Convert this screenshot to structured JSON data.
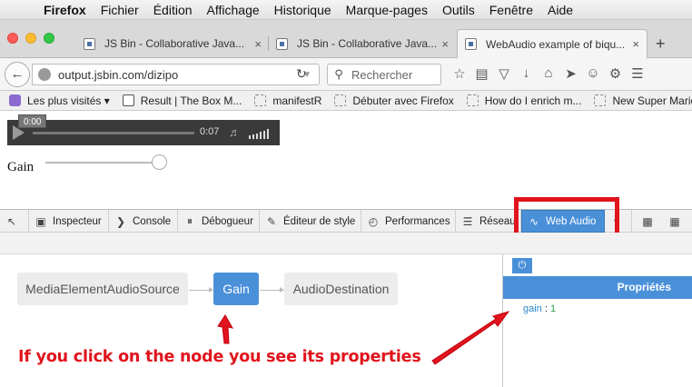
{
  "menubar": {
    "items": [
      "Firefox",
      "Fichier",
      "Édition",
      "Affichage",
      "Historique",
      "Marque-pages",
      "Outils",
      "Fenêtre",
      "Aide"
    ]
  },
  "tabs": [
    {
      "title": "JS Bin - Collaborative Java...",
      "close": "×"
    },
    {
      "title": "JS Bin - Collaborative Java...",
      "close": "×"
    },
    {
      "title": "WebAudio example of biqu...",
      "close": "×"
    }
  ],
  "newtab": "+",
  "navbar": {
    "url": "output.jsbin.com/dizipo",
    "search_placeholder": "Rechercher"
  },
  "bookmarks": [
    {
      "label": "Les plus visités ▾"
    },
    {
      "label": "Result | The Box M..."
    },
    {
      "label": "manifestR"
    },
    {
      "label": "Débuter avec Firefox"
    },
    {
      "label": "How do I enrich m..."
    },
    {
      "label": "New Super Mario B..."
    }
  ],
  "player": {
    "tooltip": "0:00",
    "time": "0:07"
  },
  "gain": {
    "label": "Gain",
    "value": 1.0
  },
  "devtools": {
    "tools": [
      {
        "label": "Inspecteur"
      },
      {
        "label": "Console"
      },
      {
        "label": "Débogueur"
      },
      {
        "label": "Éditeur de style"
      },
      {
        "label": "Performances"
      },
      {
        "label": "Réseau"
      },
      {
        "label": "Web Audio"
      }
    ]
  },
  "graph": {
    "nodes": [
      {
        "label": "MediaElementAudioSource"
      },
      {
        "label": "Gain"
      },
      {
        "label": "AudioDestination"
      }
    ]
  },
  "sidebar": {
    "header": "Propriétés",
    "prop_key": "gain",
    "prop_sep": ":",
    "prop_value": "1"
  },
  "annotation": "If you click on the node you see its properties",
  "colors": {
    "accent": "#4a90d9",
    "highlight": "#e0141c"
  }
}
